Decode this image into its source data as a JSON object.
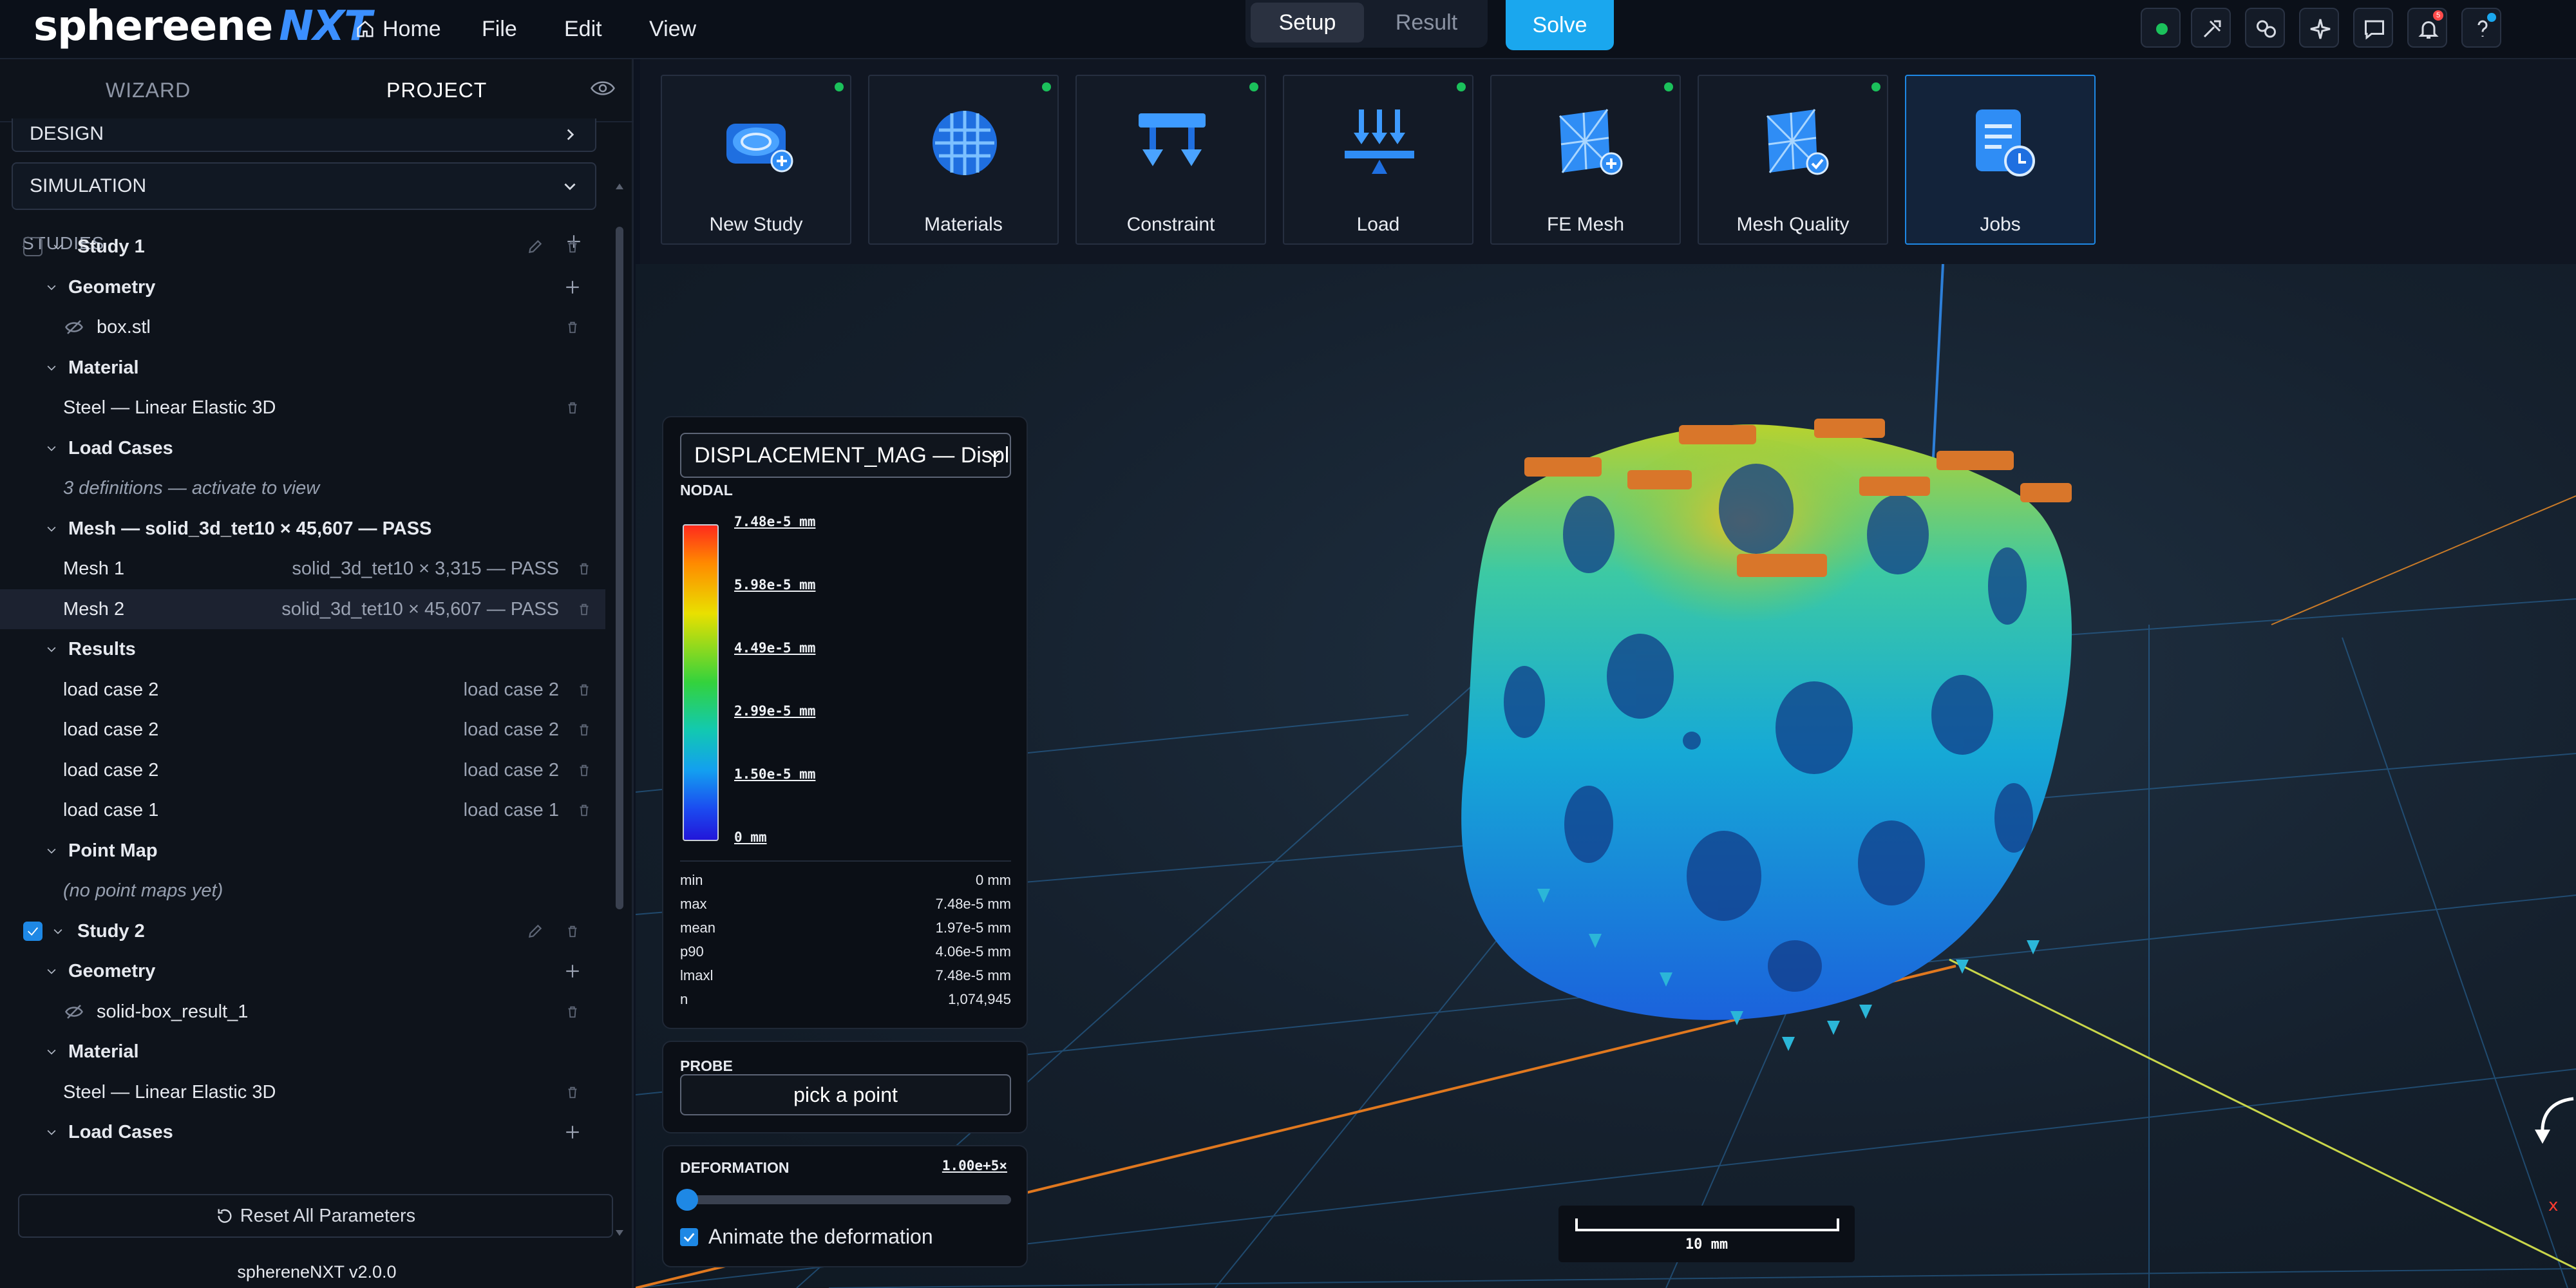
{
  "app": {
    "logo_main": "sphereene",
    "logo_accent": "NXT",
    "version": "sphereneNXT v2.0.0"
  },
  "menu": {
    "home": "Home",
    "file": "File",
    "edit": "Edit",
    "view": "View"
  },
  "mode": {
    "setup": "Setup",
    "result": "Result",
    "solve": "Solve"
  },
  "top_icons": {
    "status": "status-online",
    "notifications_badge": "5"
  },
  "sidebar": {
    "tab_wizard": "WIZARD",
    "tab_project": "PROJECT",
    "design": "DESIGN",
    "simulation": "SIMULATION",
    "studies": "STUDIES",
    "reset": "Reset All Parameters",
    "rows": [
      {
        "label": "Study 1"
      },
      {
        "label": "Geometry"
      },
      {
        "label": "box.stl"
      },
      {
        "label": "Material"
      },
      {
        "label": "Steel — Linear Elastic 3D"
      },
      {
        "label": "Load Cases"
      },
      {
        "label": "3 definitions — activate to view"
      },
      {
        "label": "Mesh — solid_3d_tet10 × 45,607 — PASS"
      },
      {
        "label": "Mesh 1",
        "value": "solid_3d_tet10 × 3,315 — PASS"
      },
      {
        "label": "Mesh 2",
        "value": "solid_3d_tet10 × 45,607 — PASS"
      },
      {
        "label": "Results"
      },
      {
        "label": "load case 2",
        "value": "load case 2"
      },
      {
        "label": "load case 2",
        "value": "load case 2"
      },
      {
        "label": "load case 2",
        "value": "load case 2"
      },
      {
        "label": "load case 1",
        "value": "load case 1"
      },
      {
        "label": "Point Map"
      },
      {
        "label": "(no point maps yet)"
      },
      {
        "label": "Study 2"
      },
      {
        "label": "Geometry"
      },
      {
        "label": "solid-box_result_1"
      },
      {
        "label": "Material"
      },
      {
        "label": "Steel — Linear Elastic 3D"
      },
      {
        "label": "Load Cases"
      }
    ]
  },
  "toolbar": {
    "tools": [
      {
        "label": "New Study",
        "icon": "new-study-icon"
      },
      {
        "label": "Materials",
        "icon": "materials-icon"
      },
      {
        "label": "Constraint",
        "icon": "constraint-icon"
      },
      {
        "label": "Load",
        "icon": "load-icon"
      },
      {
        "label": "FE Mesh",
        "icon": "fe-mesh-icon"
      },
      {
        "label": "Mesh Quality",
        "icon": "mesh-quality-icon"
      },
      {
        "label": "Jobs",
        "icon": "jobs-icon"
      }
    ]
  },
  "results": {
    "field": "DISPLACEMENT_MAG — Displa",
    "location": "NODAL",
    "ticks": [
      "7.48e-5 mm",
      "5.98e-5 mm",
      "4.49e-5 mm",
      "2.99e-5 mm",
      "1.50e-5 mm",
      "0 mm"
    ],
    "stats": [
      {
        "k": "min",
        "v": "0 mm"
      },
      {
        "k": "max",
        "v": "7.48e-5 mm"
      },
      {
        "k": "mean",
        "v": "1.97e-5 mm"
      },
      {
        "k": "p90",
        "v": "4.06e-5 mm"
      },
      {
        "k": "lmaxl",
        "v": "7.48e-5 mm"
      },
      {
        "k": "n",
        "v": "1,074,945"
      }
    ],
    "probe_title": "PROBE",
    "probe_button": "pick a point",
    "deformation_title": "DEFORMATION",
    "deformation_value": "1.00e+5×",
    "animate_label": "Animate the deformation",
    "scale_label": "10 mm"
  },
  "colors": {
    "accent": "#1aa7ee",
    "panel": "#0e131b",
    "ok": "#1bc15b"
  }
}
